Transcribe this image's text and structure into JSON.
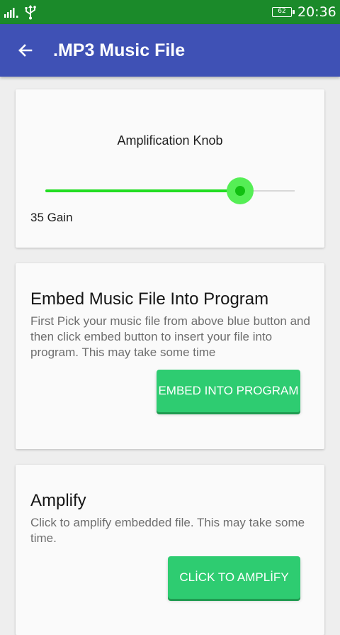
{
  "status_bar": {
    "battery_level": "62",
    "time": "20:36",
    "icons": [
      "signal-icon",
      "usb-icon",
      "battery-icon"
    ]
  },
  "app_bar": {
    "title": ".MP3 Music File",
    "back_icon": "arrow-left-icon"
  },
  "knob_card": {
    "title": "Amplification Knob",
    "gain_label": "35 Gain",
    "slider_value_fraction": 0.78
  },
  "embed_card": {
    "heading": "Embed Music File Into Program",
    "description": "First Pick your music file from above blue button and then click embed button to insert your file into program. This may take some time",
    "button_label": "EMBED INTO PROGRAM"
  },
  "amplify_card": {
    "heading": "Amplify",
    "description": "Click to amplify embedded file. This may take some time.",
    "button_label": "CLİCK TO AMPLİFY"
  },
  "colors": {
    "status_bar": "#1b8a2a",
    "app_bar": "#3f51b5",
    "accent_green": "#22dd22",
    "button_green": "#2ecc71",
    "background": "#eeeeee",
    "card": "#fafafa"
  }
}
